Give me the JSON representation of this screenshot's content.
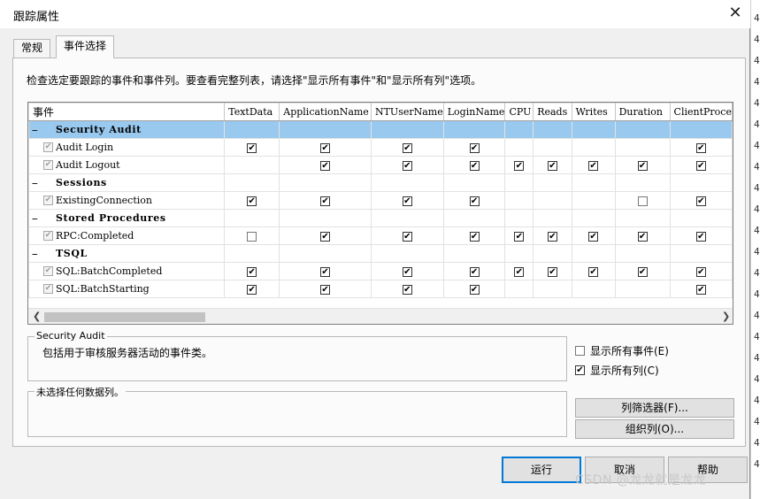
{
  "window": {
    "title": "跟踪属性"
  },
  "tabs": [
    {
      "label": "常规",
      "active": false
    },
    {
      "label": "事件选择",
      "active": true
    }
  ],
  "instruction": "检查选定要跟踪的事件和事件列。要查看完整列表，请选择\"显示所有事件\"和\"显示所有列\"选项。",
  "grid": {
    "columns": [
      "事件",
      "TextData",
      "ApplicationName",
      "NTUserName",
      "LoginName",
      "CPU",
      "Reads",
      "Writes",
      "Duration",
      "ClientProce"
    ],
    "rows": [
      {
        "type": "category",
        "label": "Security Audit",
        "selected": true
      },
      {
        "type": "event",
        "label": "Audit Login",
        "checks": [
          true,
          true,
          true,
          true,
          null,
          null,
          null,
          null,
          true
        ]
      },
      {
        "type": "event",
        "label": "Audit Logout",
        "checks": [
          null,
          true,
          true,
          true,
          true,
          true,
          true,
          true,
          true
        ]
      },
      {
        "type": "category",
        "label": "Sessions",
        "selected": false
      },
      {
        "type": "event",
        "label": "ExistingConnection",
        "checks": [
          true,
          true,
          true,
          true,
          null,
          null,
          null,
          false,
          true
        ]
      },
      {
        "type": "category",
        "label": "Stored Procedures",
        "selected": false
      },
      {
        "type": "event",
        "label": "RPC:Completed",
        "checks": [
          false,
          true,
          true,
          true,
          true,
          true,
          true,
          true,
          true
        ]
      },
      {
        "type": "category",
        "label": "TSQL",
        "selected": false
      },
      {
        "type": "event",
        "label": "SQL:BatchCompleted",
        "checks": [
          true,
          true,
          true,
          true,
          true,
          true,
          true,
          true,
          true
        ]
      },
      {
        "type": "event",
        "label": "SQL:BatchStarting",
        "checks": [
          true,
          true,
          true,
          true,
          null,
          null,
          null,
          null,
          true
        ]
      }
    ],
    "expander_glyph": "−",
    "check_glyph": "✔"
  },
  "description_group": {
    "title": "Security Audit",
    "text": "包括用于审核服务器活动的事件类。"
  },
  "column_group": {
    "title": "未选择任何数据列。"
  },
  "options": {
    "show_all_events": {
      "label": "显示所有事件(E)",
      "checked": false
    },
    "show_all_columns": {
      "label": "显示所有列(C)",
      "checked": true
    }
  },
  "buttons": {
    "column_filters": "列筛选器(F)...",
    "organize_columns": "组织列(O)...",
    "run": "运行",
    "cancel": "取消",
    "help": "帮助"
  },
  "watermark": "CSDN @龙龙就是龙龙",
  "bg_strip_chars": [
    "4",
    "4",
    "4",
    "4",
    "4",
    "4",
    "4",
    "4",
    "4",
    "4",
    "4",
    "4",
    "4",
    "4",
    "4",
    "4",
    "4",
    "4",
    "4",
    "4",
    "4",
    "4"
  ]
}
